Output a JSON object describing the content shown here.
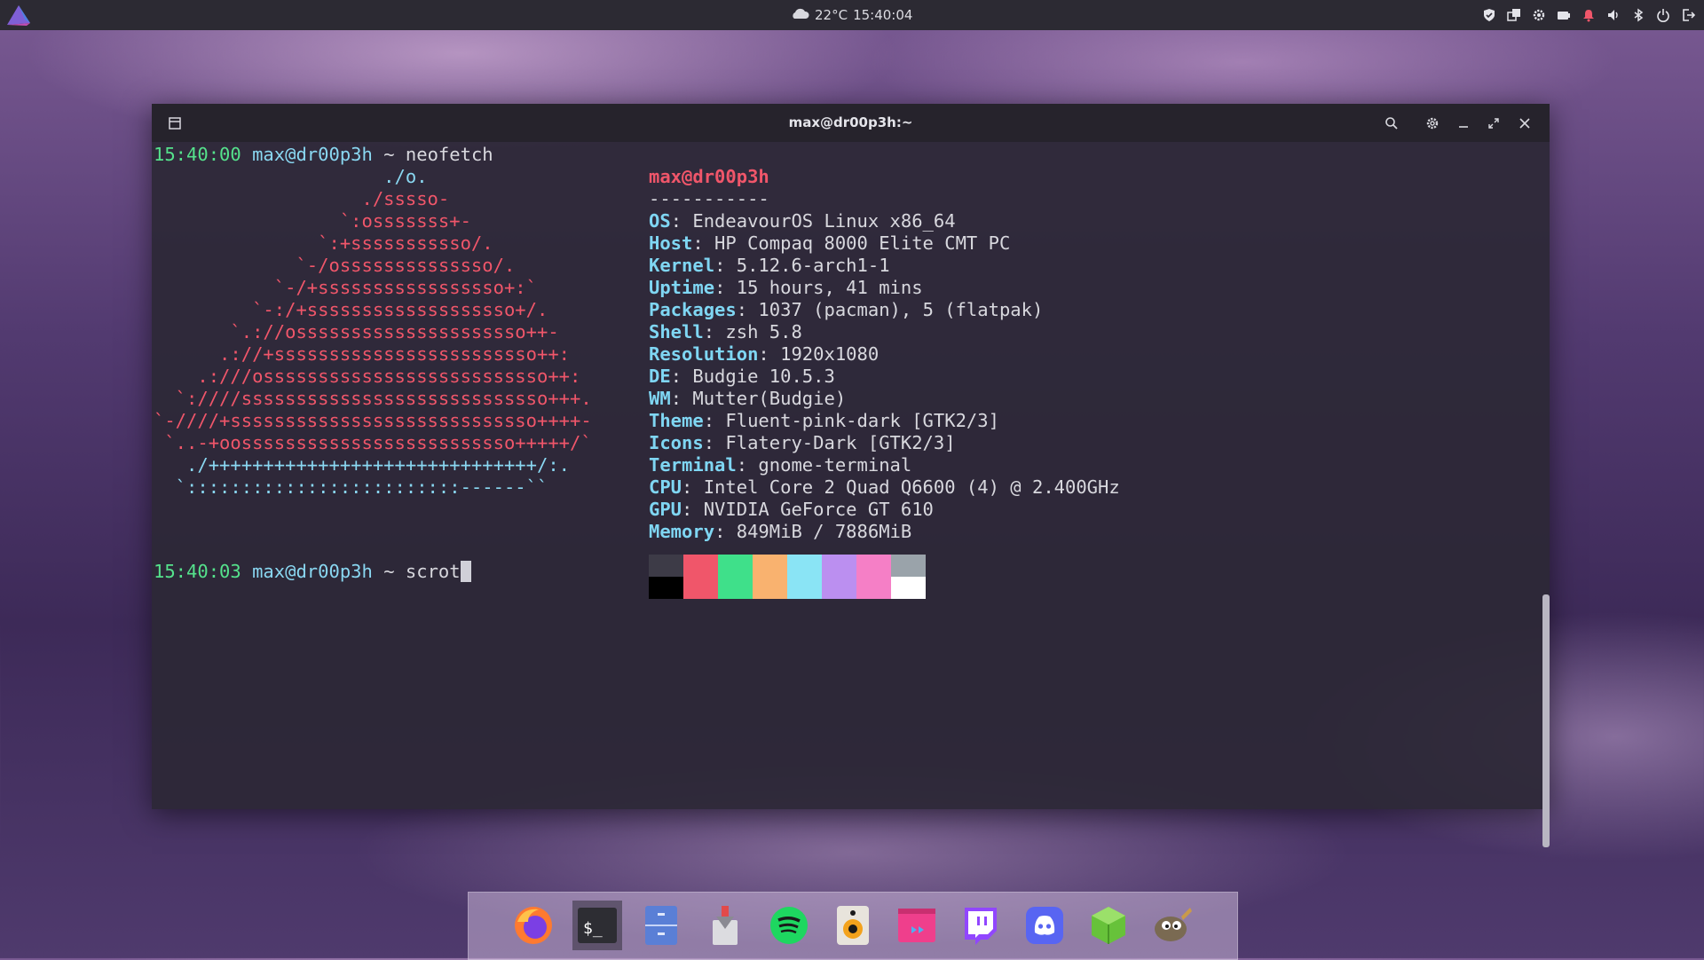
{
  "top_panel": {
    "weather": "22°C",
    "time": "15:40:04",
    "menu_icon": "endeavouros-logo-icon",
    "tray_icons": [
      "shield-icon",
      "windows-icon",
      "settings-icon",
      "battery-icon",
      "notification-icon",
      "volume-icon",
      "bluetooth-icon",
      "power-icon",
      "logout-icon"
    ]
  },
  "terminal": {
    "title": "max@dr00p3h:~",
    "prompt1": {
      "time": "15:40:00",
      "user": "max@dr00p3h",
      "path": "~",
      "command": "neofetch"
    },
    "logo_lines": [
      {
        "c": "cyan",
        "t": "                     ./o."
      },
      {
        "c": "red",
        "t": "                   ./sssso-"
      },
      {
        "c": "red",
        "t": "                 `:osssssss+-"
      },
      {
        "c": "red",
        "t": "               `:+sssssssssso/."
      },
      {
        "c": "red",
        "t": "             `-/ossssssssssssso/."
      },
      {
        "c": "red",
        "t": "           `-/+sssssssssssssssso+:`"
      },
      {
        "c": "red",
        "t": "         `-:/+sssssssssssssssssso+/."
      },
      {
        "c": "red",
        "t": "       `.://osssssssssssssssssssso++-"
      },
      {
        "c": "red",
        "t": "      .://+ssssssssssssssssssssssso++:"
      },
      {
        "c": "red",
        "t": "    .:///ossssssssssssssssssssssssso++:"
      },
      {
        "c": "red",
        "t": "  `:////ssssssssssssssssssssssssssso+++."
      },
      {
        "c": "red",
        "t": "`-////+ssssssssssssssssssssssssssso++++-"
      },
      {
        "c": "red",
        "t": " `..-+oosssssssssssssssssssssssso+++++/`"
      },
      {
        "c": "cyan",
        "t": "   ./++++++++++++++++++++++++++++++/:."
      },
      {
        "c": "cyan",
        "t": "  `:::::::::::::::::::::::::------``"
      }
    ],
    "info_header": "max@dr00p3h",
    "info_separator": "-----------",
    "info": [
      {
        "key": "OS",
        "value": "EndeavourOS Linux x86_64"
      },
      {
        "key": "Host",
        "value": "HP Compaq 8000 Elite CMT PC"
      },
      {
        "key": "Kernel",
        "value": "5.12.6-arch1-1"
      },
      {
        "key": "Uptime",
        "value": "15 hours, 41 mins"
      },
      {
        "key": "Packages",
        "value": "1037 (pacman), 5 (flatpak)"
      },
      {
        "key": "Shell",
        "value": "zsh 5.8"
      },
      {
        "key": "Resolution",
        "value": "1920x1080"
      },
      {
        "key": "DE",
        "value": "Budgie 10.5.3"
      },
      {
        "key": "WM",
        "value": "Mutter(Budgie)"
      },
      {
        "key": "Theme",
        "value": "Fluent-pink-dark [GTK2/3]"
      },
      {
        "key": "Icons",
        "value": "Flatery-Dark [GTK2/3]"
      },
      {
        "key": "Terminal",
        "value": "gnome-terminal"
      },
      {
        "key": "CPU",
        "value": "Intel Core 2 Quad Q6600 (4) @ 2.400GHz"
      },
      {
        "key": "GPU",
        "value": "NVIDIA GeForce GT 610"
      },
      {
        "key": "Memory",
        "value": "849MiB / 7886MiB"
      }
    ],
    "colors_top": [
      "#3d3b47",
      "#f0566a",
      "#3fe08a",
      "#f9b26f",
      "#8ae4f5",
      "#bb8ff0",
      "#f57fc6",
      "#9aa3aa"
    ],
    "colors_bottom": [
      "#000000",
      "#f0566a",
      "#3fe08a",
      "#f9b26f",
      "#8ae4f5",
      "#bb8ff0",
      "#f57fc6",
      "#ffffff"
    ],
    "prompt2": {
      "time": "15:40:03",
      "user": "max@dr00p3h",
      "path": "~",
      "command": "scrot"
    }
  },
  "dock": {
    "apps": [
      {
        "name": "firefox-icon"
      },
      {
        "name": "terminal-icon",
        "label": "$_"
      },
      {
        "name": "file-manager-icon"
      },
      {
        "name": "installer-icon"
      },
      {
        "name": "spotify-icon"
      },
      {
        "name": "speaker-icon"
      },
      {
        "name": "video-editor-icon"
      },
      {
        "name": "twitch-icon"
      },
      {
        "name": "discord-icon"
      },
      {
        "name": "package-icon"
      },
      {
        "name": "gimp-icon"
      }
    ]
  }
}
